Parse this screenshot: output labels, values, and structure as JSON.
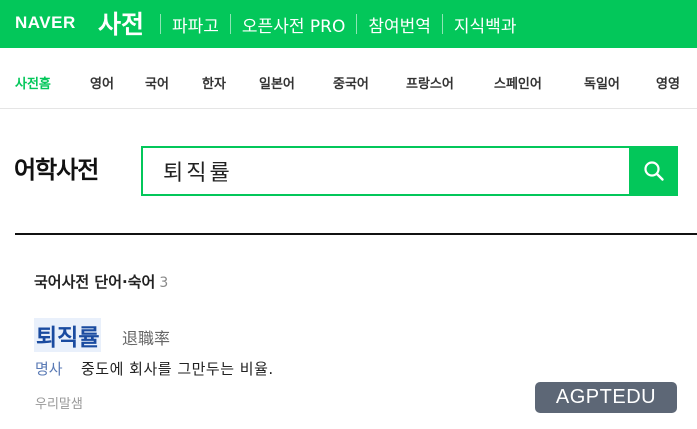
{
  "header": {
    "logo": "NAVER",
    "service_title": "사전",
    "links": [
      {
        "label": "파파고"
      },
      {
        "label": "오픈사전 PRO"
      },
      {
        "label": "참여번역"
      },
      {
        "label": "지식백과"
      }
    ]
  },
  "tabs": [
    {
      "label": "사전홈",
      "active": true
    },
    {
      "label": "영어"
    },
    {
      "label": "국어"
    },
    {
      "label": "한자"
    },
    {
      "label": "일본어"
    },
    {
      "label": "중국어"
    },
    {
      "label": "프랑스어"
    },
    {
      "label": "스페인어"
    },
    {
      "label": "독일어"
    },
    {
      "label": "영영"
    }
  ],
  "search": {
    "page_title": "어학사전",
    "query": "퇴직률",
    "button_icon": "search-icon"
  },
  "results": {
    "section_title": "국어사전 단어·숙어",
    "count": "3",
    "entry": {
      "word": "퇴직률",
      "hanja": "退職率",
      "pos": "명사",
      "definition": "중도에 회사를 그만두는 비율.",
      "source": "우리말샘"
    }
  },
  "watermark": "AGPTEDU",
  "colors": {
    "brand_green": "#03c75a",
    "entry_blue": "#1a4ba0",
    "watermark_bg": "#5d6776"
  }
}
